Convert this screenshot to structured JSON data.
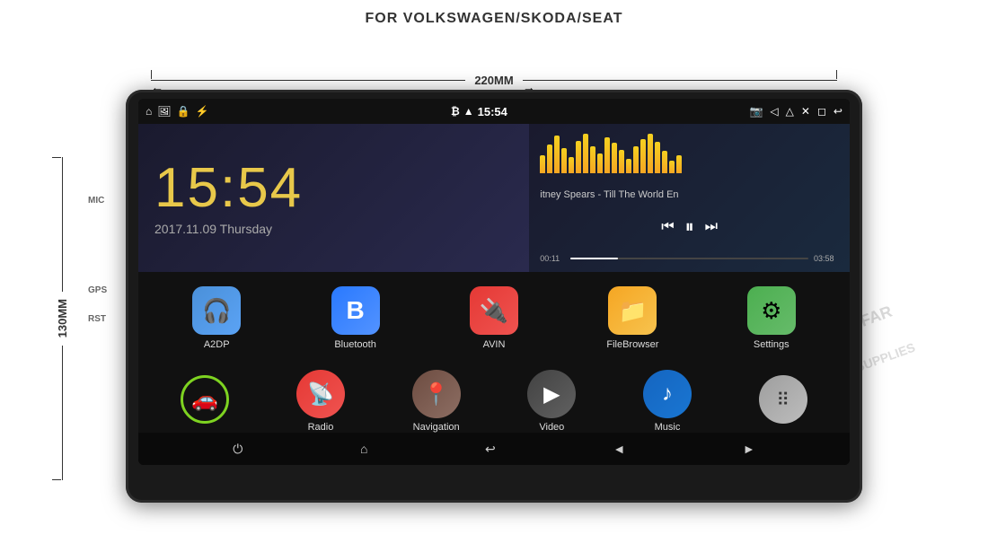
{
  "page": {
    "title": "FOR VOLKSWAGEN/SKODA/SEAT",
    "dim_width": "220MM",
    "dim_height": "130MM"
  },
  "device": {
    "side_labels": {
      "mic": "MIC",
      "gps": "GPS",
      "rst": "RST"
    }
  },
  "status_bar": {
    "time": "15:54",
    "icons_left": [
      "home",
      "image",
      "lock",
      "usb"
    ],
    "icons_center": [
      "bluetooth",
      "wifi"
    ],
    "icons_right": [
      "camera",
      "volume",
      "eject",
      "close",
      "android",
      "back"
    ]
  },
  "clock": {
    "time": "15:54",
    "date": "2017.11.09 Thursday"
  },
  "music": {
    "title": "itney Spears - Till The World En",
    "time_current": "00:11",
    "time_total": "03:58",
    "eq_bars": [
      3,
      5,
      8,
      6,
      4,
      7,
      9,
      6,
      5,
      8,
      7,
      5,
      4,
      6,
      8,
      9,
      7,
      5,
      3,
      4
    ]
  },
  "apps": [
    {
      "id": "a2dp",
      "label": "A2DP",
      "icon": "🎧",
      "color_class": "icon-a2dp"
    },
    {
      "id": "bluetooth",
      "label": "Bluetooth",
      "icon": "₿",
      "color_class": "icon-bluetooth"
    },
    {
      "id": "avin",
      "label": "AVIN",
      "icon": "🔌",
      "color_class": "icon-avin"
    },
    {
      "id": "filebrowser",
      "label": "FileBrowser",
      "icon": "📁",
      "color_class": "icon-filebrowser"
    },
    {
      "id": "settings",
      "label": "Settings",
      "icon": "⚙",
      "color_class": "icon-settings"
    }
  ],
  "bottom_apps": [
    {
      "id": "car",
      "label": "",
      "icon": "🚗",
      "color_class": "icon-car"
    },
    {
      "id": "radio",
      "label": "Radio",
      "icon": "📡",
      "color_class": "icon-radio"
    },
    {
      "id": "navigation",
      "label": "Navigation",
      "icon": "📍",
      "color_class": "icon-nav"
    },
    {
      "id": "video",
      "label": "Video",
      "icon": "▶",
      "color_class": "icon-video"
    },
    {
      "id": "music",
      "label": "Music",
      "icon": "♪",
      "color_class": "icon-music"
    },
    {
      "id": "more",
      "label": "",
      "icon": "⠿",
      "color_class": "icon-more"
    }
  ],
  "nav_bar": {
    "buttons": [
      "⏻",
      "⌂",
      "↩",
      "◄",
      "►"
    ]
  },
  "watermark": "JAFAFAR",
  "watermark2": "SUPPLIES"
}
